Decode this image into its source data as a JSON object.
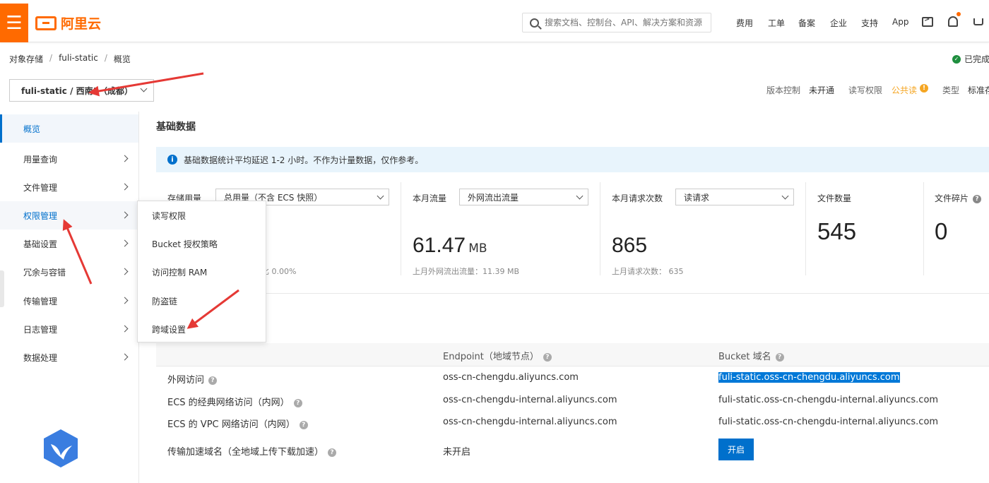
{
  "header": {
    "menu_icon": "hamburger-icon",
    "logo_text": "阿里云",
    "search_placeholder": "搜索文档、控制台、API、解决方案和资源",
    "nav": [
      "费用",
      "工单",
      "备案",
      "企业",
      "支持",
      "App"
    ]
  },
  "breadcrumb": [
    "对象存储",
    "fuli-static",
    "概览"
  ],
  "status_done": "已完成",
  "bucket_selector": "fuli-static / 西南1（成都）",
  "bucket_meta": {
    "version_label": "版本控制",
    "version_value": "未开通",
    "acl_label": "读写权限",
    "acl_value": "公共读",
    "type_label": "类型",
    "type_value": "标准存"
  },
  "sidebar": {
    "items": [
      "概览",
      "用量查询",
      "文件管理",
      "权限管理",
      "基础设置",
      "冗余与容错",
      "传输管理",
      "日志管理",
      "数据处理"
    ]
  },
  "popup_menu": [
    "读写权限",
    "Bucket 授权策略",
    "访问控制 RAM",
    "防盗链",
    "跨域设置"
  ],
  "section_title": "基础数据",
  "notice": "基础数据统计平均延迟 1-2 小时。不作为计量数据，仅作参考。",
  "stats": {
    "storage": {
      "label": "存储用量",
      "select": "总用量（不含 ECS 快照）",
      "sub": "比 0.00%"
    },
    "traffic": {
      "label": "本月流量",
      "select": "外网流出流量",
      "value": "61.47",
      "unit": "MB",
      "sub": "上月外网流出流量：11.39 MB"
    },
    "requests": {
      "label": "本月请求次数",
      "select": "读请求",
      "value": "865",
      "sub": "上月请求次数：  635"
    },
    "files": {
      "label": "文件数量",
      "value": "545"
    },
    "fragments": {
      "label": "文件碎片",
      "value": "0"
    }
  },
  "table": {
    "col_endpoint": "Endpoint（地域节点）",
    "col_domain": "Bucket 域名",
    "rows": [
      {
        "name": "外网访问",
        "endpoint": "oss-cn-chengdu.aliyuncs.com",
        "domain": "fuli-static.oss-cn-chengdu.aliyuncs.com"
      },
      {
        "name": "ECS 的经典网络访问（内网）",
        "endpoint": "oss-cn-chengdu-internal.aliyuncs.com",
        "domain": "fuli-static.oss-cn-chengdu-internal.aliyuncs.com"
      },
      {
        "name": "ECS 的 VPC 网络访问（内网）",
        "endpoint": "oss-cn-chengdu-internal.aliyuncs.com",
        "domain": "fuli-static.oss-cn-chengdu-internal.aliyuncs.com"
      },
      {
        "name": "传输加速域名（全地域上传下载加速）",
        "endpoint": "未开启",
        "button": "开启"
      }
    ]
  },
  "colors": {
    "brand": "#ff6a00",
    "primary": "#0070cc",
    "annotation_arrow": "#e53935"
  }
}
